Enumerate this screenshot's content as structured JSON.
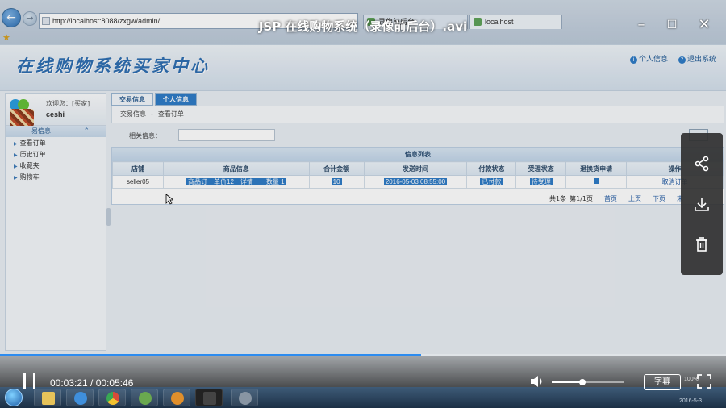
{
  "video": {
    "title": "JSP 在线购物系统（录像前后台）.avi",
    "time_display": "00:03:21 / 00:05:46",
    "progress": 0.58,
    "volume": 0.42,
    "subtitle_label": "字幕"
  },
  "browser": {
    "url": "http://localhost:8088/zxgw/admin/",
    "tabs": [
      "录像前后台",
      "localhost"
    ]
  },
  "app": {
    "title": "在线购物系统买家中心",
    "links": {
      "profile": "个人信息",
      "logout": "退出系统"
    }
  },
  "sidebar": {
    "welcome": "欢迎您：[买家]",
    "username": "ceshi",
    "menu_head": "易信息",
    "items": [
      "查看订单",
      "历史订单",
      "收藏夹",
      "购物车"
    ]
  },
  "content": {
    "tabs": [
      "交易信息",
      "个人信息"
    ],
    "breadcrumb": [
      "交易信息",
      "查看订单"
    ],
    "search_label": "相关信息：",
    "list_title": "信息列表",
    "columns": [
      "店铺",
      "商品信息",
      "合计金额",
      "发送时间",
      "付款状态",
      "受理状态",
      "退换货申请",
      "操作"
    ],
    "rows": [
      {
        "shop": "seller05",
        "product": "商品订　单价12　详情　　数量 1",
        "total": "10",
        "time": "2016-05-03 08:55:00",
        "pay_status": "已付款",
        "accept_status": "待受理",
        "action": "取消订单"
      }
    ],
    "pager": {
      "summary": "共1条",
      "page": "第1/1页",
      "first": "首页",
      "prev": "上页",
      "next": "下页",
      "last": "末"
    }
  },
  "system": {
    "date": "2016-5-3",
    "zoom": "100%"
  },
  "colors": {
    "accent": "#2f7cc7",
    "progress": "#2d8cf0"
  }
}
